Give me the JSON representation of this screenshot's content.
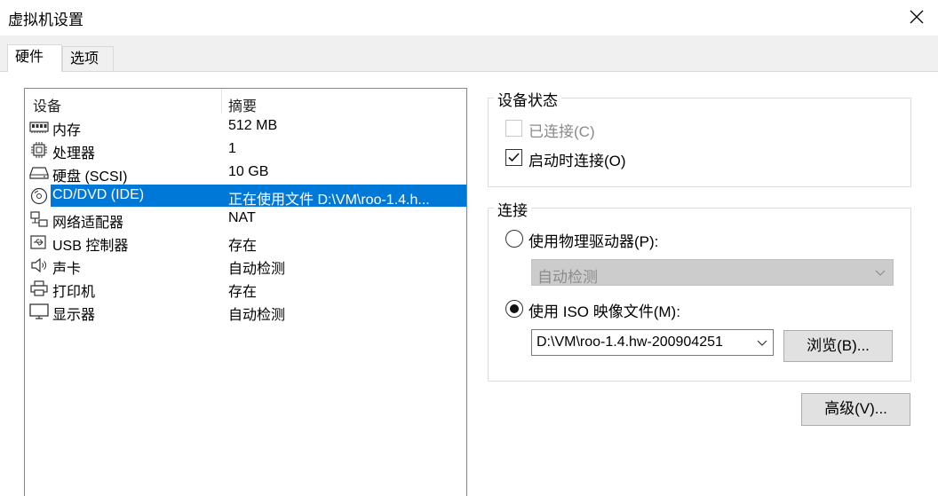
{
  "window": {
    "title": "虚拟机设置"
  },
  "tabs": [
    {
      "label": "硬件",
      "active": true
    },
    {
      "label": "选项",
      "active": false
    }
  ],
  "device_list": {
    "headers": [
      "设备",
      "摘要"
    ],
    "rows": [
      {
        "icon": "memory-icon",
        "name": "内存",
        "summary": "512 MB",
        "selected": false
      },
      {
        "icon": "processor-icon",
        "name": "处理器",
        "summary": "1",
        "selected": false
      },
      {
        "icon": "harddisk-icon",
        "name": "硬盘 (SCSI)",
        "summary": "10 GB",
        "selected": false
      },
      {
        "icon": "cdrom-icon",
        "name": "CD/DVD (IDE)",
        "summary": "正在使用文件 D:\\VM\\roo-1.4.h...",
        "selected": true
      },
      {
        "icon": "network-adapter-icon",
        "name": "网络适配器",
        "summary": "NAT",
        "selected": false
      },
      {
        "icon": "usb-icon",
        "name": "USB 控制器",
        "summary": "存在",
        "selected": false
      },
      {
        "icon": "sound-icon",
        "name": "声卡",
        "summary": "自动检测",
        "selected": false
      },
      {
        "icon": "printer-icon",
        "name": "打印机",
        "summary": "存在",
        "selected": false
      },
      {
        "icon": "display-icon",
        "name": "显示器",
        "summary": "自动检测",
        "selected": false
      }
    ]
  },
  "device_status": {
    "title": "设备状态",
    "connected": {
      "label": "已连接(C)",
      "checked": false,
      "disabled": true
    },
    "connect_at_power_on": {
      "label": "启动时连接(O)",
      "checked": true
    }
  },
  "connection": {
    "title": "连接",
    "physical_drive": {
      "label": "使用物理驱动器(P):",
      "selected": false,
      "value": "自动检测"
    },
    "iso_image": {
      "label": "使用 ISO 映像文件(M):",
      "selected": true,
      "value": "D:\\VM\\roo-1.4.hw-200904251"
    },
    "browse_label": "浏览(B)..."
  },
  "advanced_label": "高级(V)..."
}
